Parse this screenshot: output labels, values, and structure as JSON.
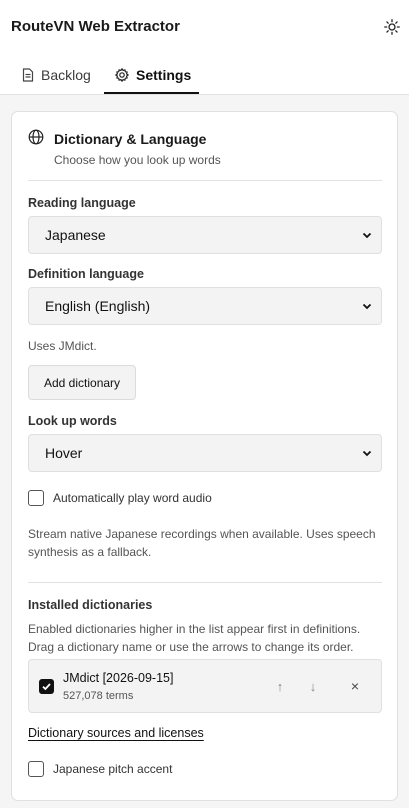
{
  "app": {
    "title": "RouteVN Web Extractor"
  },
  "tabs": [
    {
      "label": "Backlog",
      "icon": "document-icon",
      "active": false
    },
    {
      "label": "Settings",
      "icon": "gear-icon",
      "active": true
    }
  ],
  "section": {
    "title": "Dictionary & Language",
    "subtitle": "Choose how you look up words",
    "icon": "globe-icon"
  },
  "reading_language": {
    "label": "Reading language",
    "value": "Japanese"
  },
  "definition_language": {
    "label": "Definition language",
    "value": "English (English)",
    "note": "Uses JMdict."
  },
  "add_dictionary": {
    "label": "Add dictionary"
  },
  "lookup": {
    "label": "Look up words",
    "value": "Hover"
  },
  "auto_audio": {
    "label": "Automatically play word audio",
    "checked": false,
    "description": "Stream native Japanese recordings when available. Uses speech synthesis as a fallback."
  },
  "installed": {
    "label": "Installed dictionaries",
    "description": "Enabled dictionaries higher in the list appear first in definitions. Drag a dictionary name or use the arrows to change its order.",
    "items": [
      {
        "name": "JMdict [2026-09-15]",
        "terms": "527,078 terms",
        "enabled": true
      }
    ],
    "controls": {
      "up": "↑",
      "down": "↓",
      "remove": "×"
    }
  },
  "sources_link": "Dictionary sources and licenses",
  "pitch_accent": {
    "label": "Japanese pitch accent",
    "checked": false
  },
  "colors": {
    "accent": "#111111",
    "panel": "#f3f3f3",
    "border": "#e0e0e0",
    "page_bg": "#f5f5f5"
  }
}
